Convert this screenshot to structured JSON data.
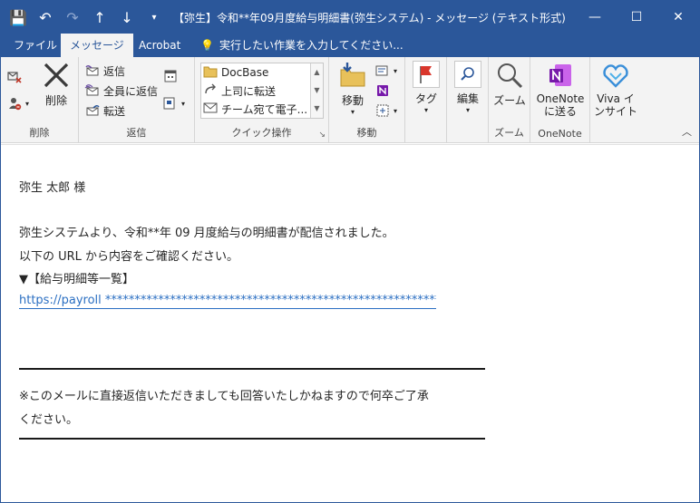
{
  "window": {
    "title": "【弥生】令和**年09月度給与明細書(弥生システム)  -  メッセージ (テキスト形式)",
    "controls": {
      "minimize": "—",
      "restore": "☐",
      "close": "✕"
    }
  },
  "quick_access": {
    "save": "💾",
    "undo": "↶",
    "redo": "↷",
    "up": "↑",
    "down": "↓",
    "customize": "▾"
  },
  "tabs": [
    {
      "label": "ファイル"
    },
    {
      "label": "メッセージ"
    },
    {
      "label": "Acrobat"
    }
  ],
  "tell_me": {
    "icon": "💡",
    "placeholder": "実行したい作業を入力してください..."
  },
  "ribbon": {
    "delete_group": {
      "label": "削除",
      "delete": "削除"
    },
    "reply_group": {
      "label": "返信",
      "reply": "返信",
      "reply_all": "全員に返信",
      "forward": "転送"
    },
    "quick_group": {
      "label": "クイック操作",
      "items": [
        "DocBase",
        "上司に転送",
        "チーム宛て電子..."
      ]
    },
    "move_group": {
      "label": "移動",
      "move": "移動"
    },
    "tags_group": {
      "tags": "タグ"
    },
    "edit_group": {
      "edit": "編集"
    },
    "zoom_group": {
      "label": "ズーム",
      "zoom": "ズーム"
    },
    "onenote_group": {
      "label": "OneNote",
      "send": "OneNote\nに送る"
    },
    "viva_group": {
      "viva": "Viva イ\nンサイト"
    }
  },
  "message": {
    "greeting": "弥生  太郎  様",
    "line1": "弥生システムより、令和**年 09 月度給与の明細書が配信されました。",
    "line2": "以下の URL から内容をご確認ください。",
    "line3": "▼【給与明細等一覧】",
    "url": "https://payroll *****************************************************************",
    "notice1": "※このメールに直接返信いただきましても回答いたしかねますので何卒ご了承",
    "notice2": "ください。"
  },
  "colors": {
    "accent": "#2b579a",
    "link": "#2b6fc2"
  }
}
